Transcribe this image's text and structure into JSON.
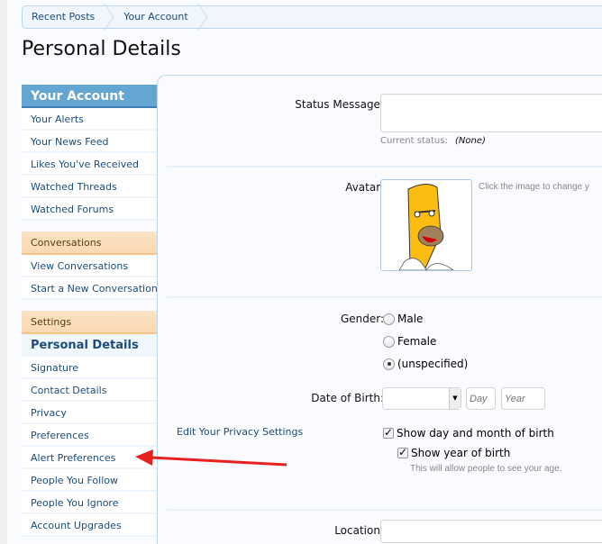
{
  "breadcrumb": [
    "Recent Posts",
    "Your Account"
  ],
  "page_title": "Personal Details",
  "sidebar": {
    "header": "Your Account",
    "items": [
      "Your Alerts",
      "Your News Feed",
      "Likes You've Received",
      "Watched Threads",
      "Watched Forums"
    ],
    "conversations": {
      "title": "Conversations",
      "items": [
        "View Conversations",
        "Start a New Conversation"
      ]
    },
    "settings": {
      "title": "Settings",
      "items": [
        "Personal Details",
        "Signature",
        "Contact Details",
        "Privacy",
        "Preferences",
        "Alert Preferences",
        "People You Follow",
        "People You Ignore",
        "Account Upgrades"
      ],
      "active": "Personal Details"
    }
  },
  "form": {
    "status_label": "Status Message:",
    "status_value": "",
    "current_status_label": "Current status:",
    "current_status_value": "(None)",
    "avatar_label": "Avatar:",
    "avatar_hint": "Click the image to change y",
    "gender_label": "Gender:",
    "gender_options": [
      "Male",
      "Female",
      "(unspecified)"
    ],
    "gender_selected": "(unspecified)",
    "dob_label": "Date of Birth:",
    "month_value": "",
    "day_placeholder": "Day",
    "year_placeholder": "Year",
    "privacy_link": "Edit Your Privacy Settings",
    "show_day_month": "Show day and month of birth",
    "show_day_month_checked": true,
    "show_year": "Show year of birth",
    "show_year_checked": true,
    "show_year_hint": "This will allow people to see your age.",
    "location_label": "Location:",
    "location_value": ""
  },
  "annotation": {
    "arrow_color": "#e82020",
    "points_to": "Alert Preferences"
  }
}
